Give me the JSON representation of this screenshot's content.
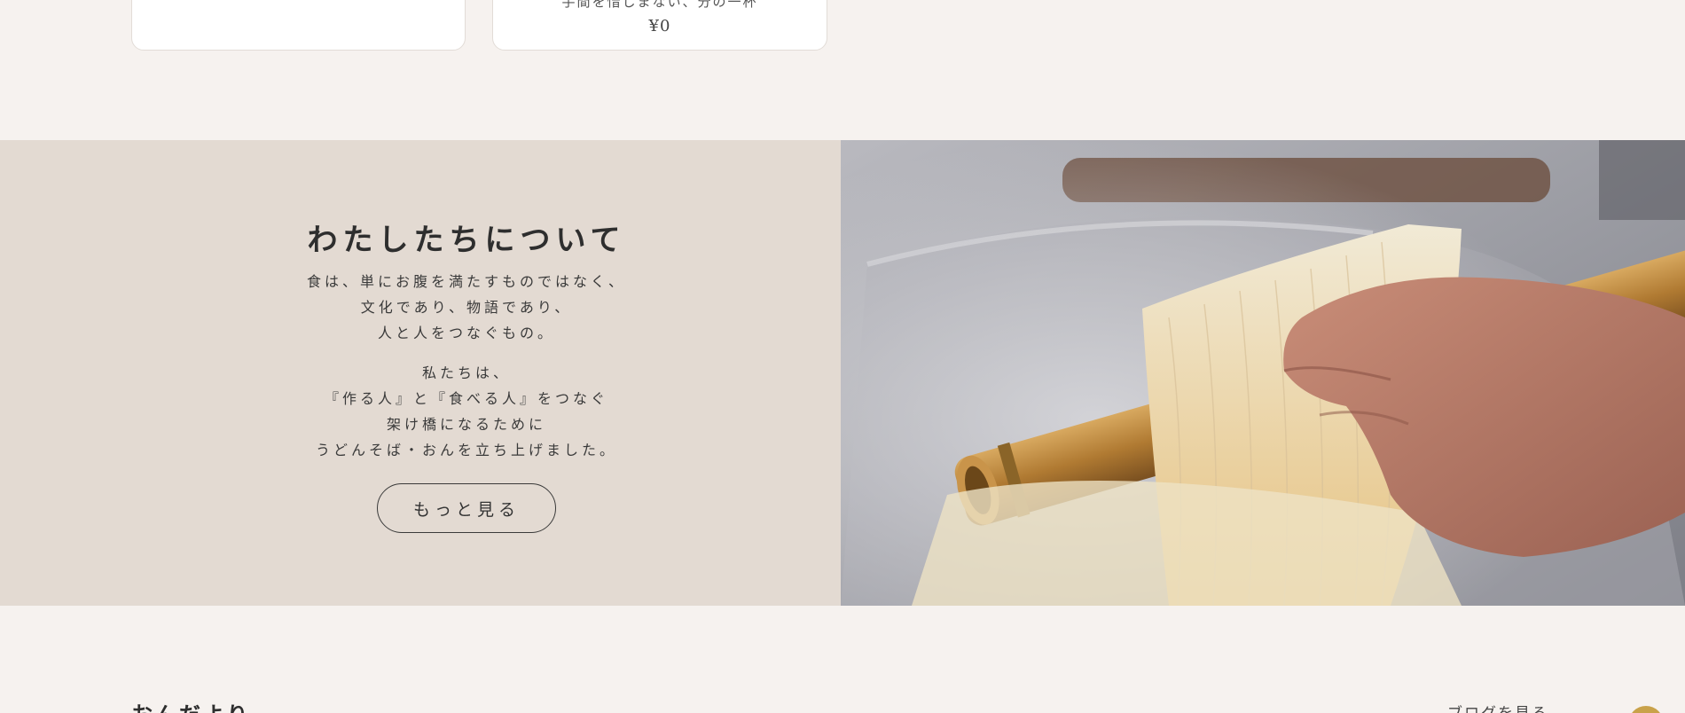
{
  "products": [
    {
      "desc": "",
      "price": ""
    },
    {
      "desc": "手間を惜しまない、分の一杯",
      "price": "¥0"
    }
  ],
  "about": {
    "title": "わたしたちについて",
    "paragraph1": [
      "食は、単にお腹を満たすものではなく、",
      "文化であり、物語であり、",
      "人と人をつなぐもの。"
    ],
    "paragraph2": [
      "私たちは、",
      "『作る人』と『食べる人』をつなぐ",
      "架け橋になるために",
      "うどんそば・おんを立ち上げました。"
    ],
    "button_label": "もっと見る",
    "photo_alt": "udon-noodles-on-bamboo-pole"
  },
  "blog": {
    "title": "おんだより",
    "link_label": "ブログを見る"
  },
  "colors": {
    "page_bg": "#f6f2ef",
    "about_bg": "#e3dad2",
    "text": "#333333",
    "accent": "#c9a24a"
  }
}
